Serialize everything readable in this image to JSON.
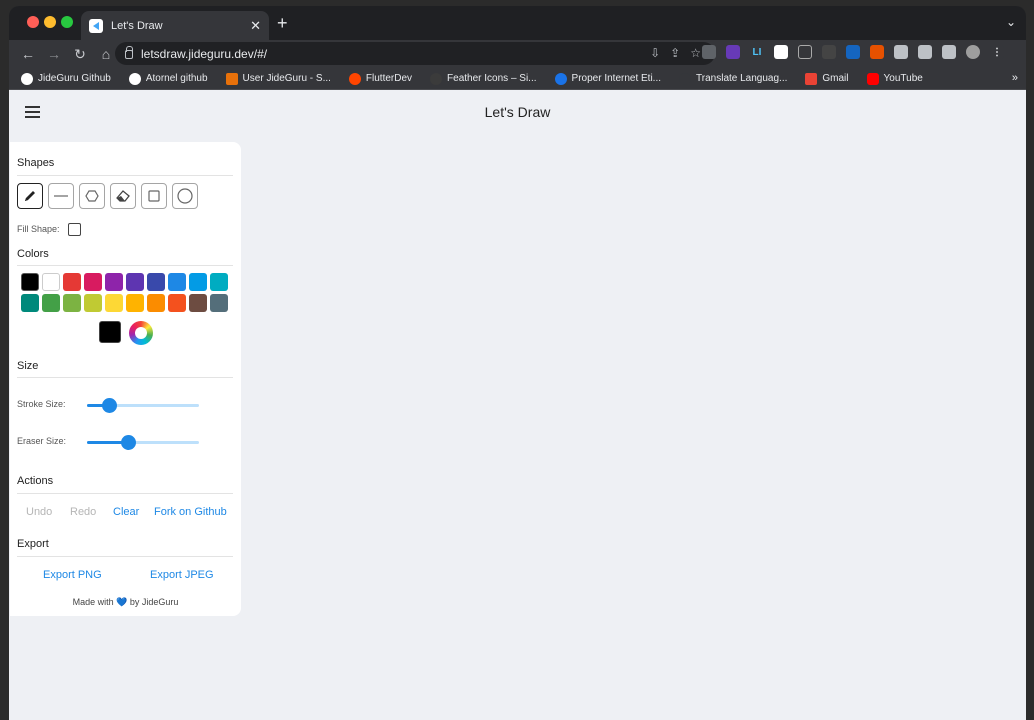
{
  "browser": {
    "tab_title": "Let's Draw",
    "tab_close": "✕",
    "new_tab": "+",
    "tab_menu": "⌄",
    "url": "letsdraw.jideguru.dev/#/",
    "nav": {
      "back": "←",
      "forward": "→",
      "reload": "↻",
      "home": "⌂"
    },
    "omnibox_icons": [
      "⇩",
      "⇪",
      "☆"
    ],
    "bookmarks": [
      {
        "label": "JideGuru Github",
        "icon_color": "#ffffff"
      },
      {
        "label": "Atornel github",
        "icon_color": "#ffffff"
      },
      {
        "label": "User JideGuru - S...",
        "icon_color": "#e8710a"
      },
      {
        "label": "FlutterDev",
        "icon_color": "#ff4500"
      },
      {
        "label": "Feather Icons – Si...",
        "icon_color": "#3b3b3b"
      },
      {
        "label": "Proper Internet Eti...",
        "icon_color": "#1a73e8"
      },
      {
        "label": "Translate Languag...",
        "icon_color": "#35363a"
      },
      {
        "label": "Gmail",
        "icon_color": "#ea4335"
      },
      {
        "label": "YouTube",
        "icon_color": "#ff0000"
      }
    ],
    "bookmarks_more": "»"
  },
  "app": {
    "title": "Let's Draw",
    "sections": {
      "shapes": "Shapes",
      "colors": "Colors",
      "size": "Size",
      "actions": "Actions",
      "export": "Export"
    },
    "fill_shape_label": "Fill Shape:",
    "fill_shape_checked": false,
    "shape_tools": [
      "pencil-icon",
      "line-icon",
      "polygon-icon",
      "eraser-icon",
      "square-icon",
      "circle-icon"
    ],
    "active_tool": "pencil",
    "palette": [
      "#000000",
      "#ffffff",
      "#e53935",
      "#d81b60",
      "#8e24aa",
      "#5e35b1",
      "#3949ab",
      "#1e88e5",
      "#039be5",
      "#00acc1",
      "#00897b",
      "#43a047",
      "#7cb342",
      "#c0ca33",
      "#fdd835",
      "#ffb300",
      "#fb8c00",
      "#f4511e",
      "#6d4c41",
      "#546e7a"
    ],
    "current_color": "#000000",
    "stroke_size_label": "Stroke Size:",
    "stroke_size_fraction": 0.2,
    "eraser_size_label": "Eraser Size:",
    "eraser_size_fraction": 0.37,
    "actions": {
      "undo": "Undo",
      "redo": "Redo",
      "clear": "Clear",
      "fork": "Fork on Github"
    },
    "export": {
      "png": "Export PNG",
      "jpeg": "Export JPEG"
    },
    "footer": {
      "prefix": "Made with",
      "heart": "💙",
      "suffix": "by JideGuru"
    },
    "accent_color": "#1e88e5"
  }
}
